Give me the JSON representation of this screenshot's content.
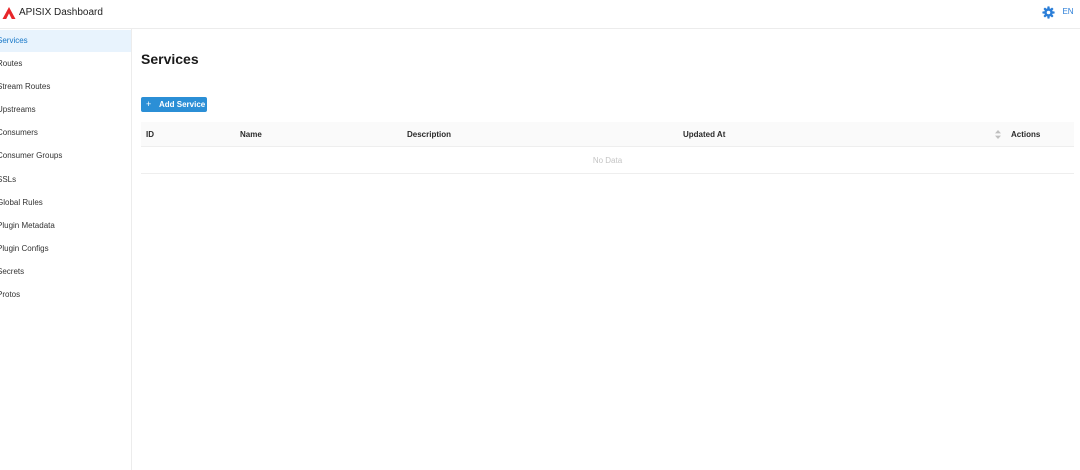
{
  "header": {
    "app_title": "APISIX Dashboard",
    "language_label": "EN",
    "logo_color": "#e8262a",
    "accent_color": "#1677c8",
    "settings_icon": "gear-icon"
  },
  "sidebar": {
    "items": [
      {
        "label": "Services",
        "active": true
      },
      {
        "label": "Routes",
        "active": false
      },
      {
        "label": "Stream Routes",
        "active": false
      },
      {
        "label": "Upstreams",
        "active": false
      },
      {
        "label": "Consumers",
        "active": false
      },
      {
        "label": "Consumer Groups",
        "active": false
      },
      {
        "label": "SSLs",
        "active": false
      },
      {
        "label": "Global Rules",
        "active": false
      },
      {
        "label": "Plugin Metadata",
        "active": false
      },
      {
        "label": "Plugin Configs",
        "active": false
      },
      {
        "label": "Secrets",
        "active": false
      },
      {
        "label": "Protos",
        "active": false
      }
    ]
  },
  "main": {
    "title": "Services",
    "add_button_label": "Add Service",
    "table": {
      "columns": [
        "ID",
        "Name",
        "Description",
        "Updated At",
        "Actions"
      ],
      "empty_text": "No Data",
      "rows": []
    }
  }
}
